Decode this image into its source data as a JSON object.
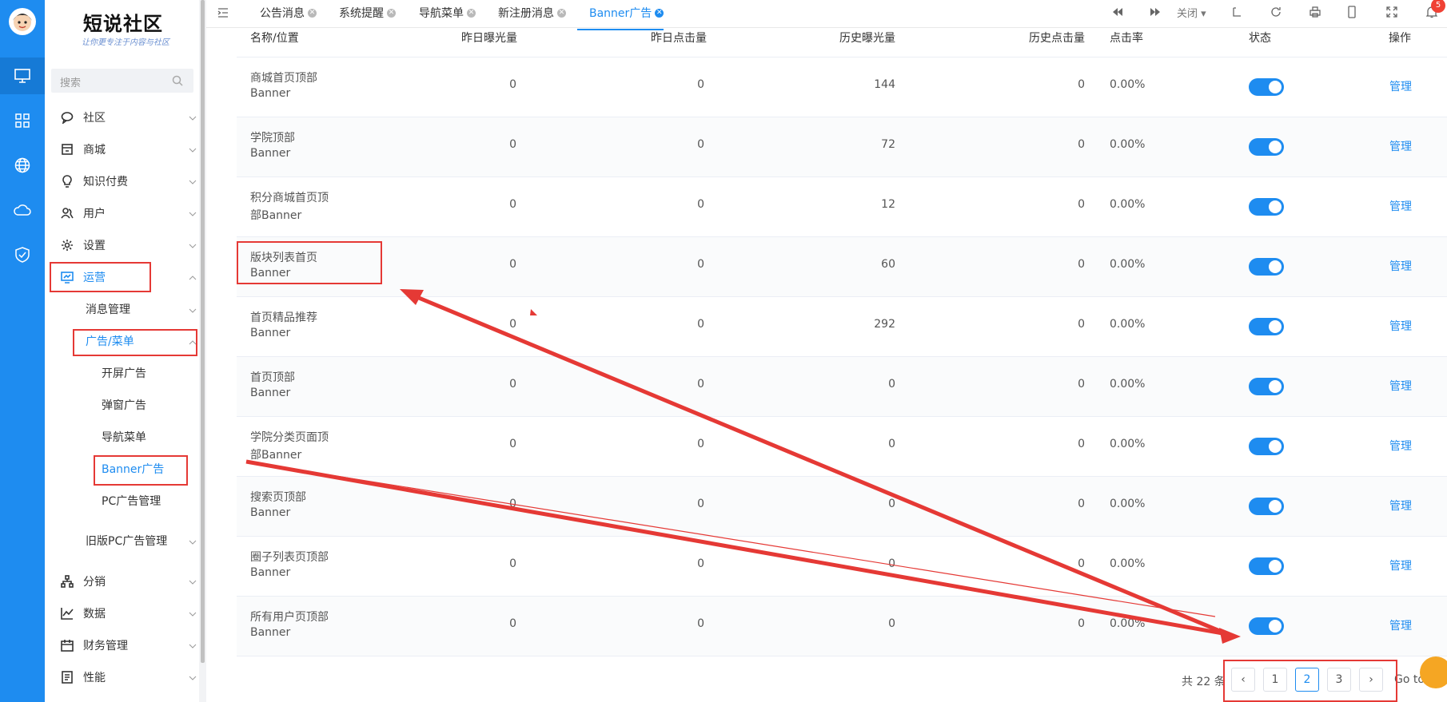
{
  "app": {
    "brand": "短说社区",
    "brand_sub": "让你更专注于内容与社区",
    "notification_count": "5"
  },
  "rail": {
    "icons": [
      "monitor-icon",
      "grid-icon",
      "globe-icon",
      "cloud-icon",
      "shield-check-icon"
    ]
  },
  "sidebar": {
    "search_placeholder": "搜索",
    "items": [
      {
        "label": "社区",
        "icon": "chat-icon"
      },
      {
        "label": "商城",
        "icon": "store-icon"
      },
      {
        "label": "知识付费",
        "icon": "bulb-icon"
      },
      {
        "label": "用户",
        "icon": "users-icon"
      },
      {
        "label": "设置",
        "icon": "gear-icon"
      },
      {
        "label": "运营",
        "icon": "monitor-chart-icon"
      }
    ],
    "operations": {
      "message_mgmt": "消息管理",
      "ads_menu": "广告/菜单",
      "ads_children": [
        "开屏广告",
        "弹窗广告",
        "导航菜单",
        "Banner广告",
        "PC广告管理"
      ],
      "old_pc_ads": "旧版PC广告管理"
    },
    "bottom_items": [
      {
        "label": "分销",
        "icon": "sitemap-icon"
      },
      {
        "label": "数据",
        "icon": "line-chart-icon"
      },
      {
        "label": "财务管理",
        "icon": "calendar-icon"
      },
      {
        "label": "性能",
        "icon": "document-icon"
      }
    ]
  },
  "tabs": {
    "items": [
      "公告消息",
      "系统提醒",
      "导航菜单",
      "新注册消息",
      "Banner广告"
    ],
    "active": "Banner广告",
    "close_label": "关闭"
  },
  "table": {
    "headers": [
      "名称/位置",
      "昨日曝光量",
      "昨日点击量",
      "历史曝光量",
      "历史点击量",
      "点击率",
      "状态",
      "操作"
    ],
    "rows": [
      {
        "name1": "商城首页顶部",
        "name2": "Banner",
        "yest_exp": "0",
        "yest_click": "0",
        "hist_exp": "144",
        "hist_click": "0",
        "rate": "0.00%",
        "status": true,
        "action": "管理"
      },
      {
        "name1": "学院顶部",
        "name2": "Banner",
        "yest_exp": "0",
        "yest_click": "0",
        "hist_exp": "72",
        "hist_click": "0",
        "rate": "0.00%",
        "status": true,
        "action": "管理"
      },
      {
        "name1": "积分商城首页顶",
        "name2": "部Banner",
        "yest_exp": "0",
        "yest_click": "0",
        "hist_exp": "12",
        "hist_click": "0",
        "rate": "0.00%",
        "status": true,
        "action": "管理"
      },
      {
        "name1": "版块列表首页",
        "name2": "Banner",
        "yest_exp": "0",
        "yest_click": "0",
        "hist_exp": "60",
        "hist_click": "0",
        "rate": "0.00%",
        "status": true,
        "action": "管理"
      },
      {
        "name1": "首页精品推荐",
        "name2": "Banner",
        "yest_exp": "0",
        "yest_click": "0",
        "hist_exp": "292",
        "hist_click": "0",
        "rate": "0.00%",
        "status": true,
        "action": "管理"
      },
      {
        "name1": "首页顶部",
        "name2": "Banner",
        "yest_exp": "0",
        "yest_click": "0",
        "hist_exp": "0",
        "hist_click": "0",
        "rate": "0.00%",
        "status": true,
        "action": "管理"
      },
      {
        "name1": "学院分类页面顶",
        "name2": "部Banner",
        "yest_exp": "0",
        "yest_click": "0",
        "hist_exp": "0",
        "hist_click": "0",
        "rate": "0.00%",
        "status": true,
        "action": "管理"
      },
      {
        "name1": "搜索页顶部",
        "name2": "Banner",
        "yest_exp": "0",
        "yest_click": "0",
        "hist_exp": "0",
        "hist_click": "0",
        "rate": "0.00%",
        "status": true,
        "action": "管理"
      },
      {
        "name1": "圈子列表页顶部",
        "name2": "Banner",
        "yest_exp": "0",
        "yest_click": "0",
        "hist_exp": "0",
        "hist_click": "0",
        "rate": "0.00%",
        "status": true,
        "action": "管理"
      },
      {
        "name1": "所有用户页顶部",
        "name2": "Banner",
        "yest_exp": "0",
        "yest_click": "0",
        "hist_exp": "0",
        "hist_click": "0",
        "rate": "0.00%",
        "status": true,
        "action": "管理"
      }
    ]
  },
  "pagination": {
    "total": "共 22 条",
    "pages": [
      "1",
      "2",
      "3"
    ],
    "current": "2",
    "goto": "Go to"
  },
  "colors": {
    "primary": "#1e8cf0",
    "annotation": "#e53935"
  }
}
